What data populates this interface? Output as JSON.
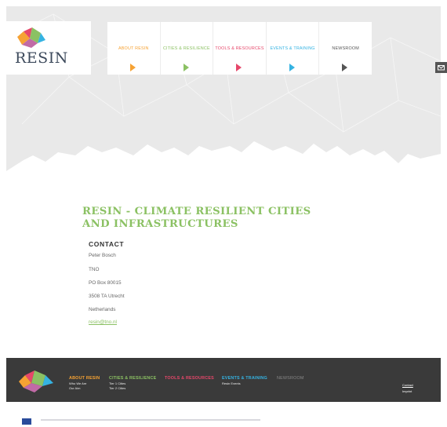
{
  "brand": {
    "name": "RESIN"
  },
  "nav": [
    {
      "label": "ABOUT RESIN",
      "color": "#f6a233"
    },
    {
      "label": "CITIES & RESILIENCE",
      "color": "#8bc163"
    },
    {
      "label": "TOOLS & RESOURCES",
      "color": "#e6476a"
    },
    {
      "label": "EVENTS & TRAINING",
      "color": "#35b3e2"
    },
    {
      "label": "NEWSROOM",
      "color": "#555555"
    }
  ],
  "content": {
    "title": "RESIN - CLIMATE RESILIENT CITIES AND INFRASTRUCTURES",
    "contact_heading": "CONTACT",
    "contact_lines": [
      "Peter Bosch",
      "TNO",
      "PO Box 80015",
      "3508 TA Utrecht",
      "Netherlands"
    ],
    "contact_email": "resin@tno.nl"
  },
  "footer": {
    "columns": [
      {
        "title": "ABOUT RESIN",
        "color": "#f6a233",
        "items": [
          "Who We Are",
          "Our Aim"
        ]
      },
      {
        "title": "CITIES & RESILIENCE",
        "color": "#8bc163",
        "items": [
          "Tier 1 Cities",
          "Tier 2 Cities"
        ]
      },
      {
        "title": "TOOLS & RESOURCES",
        "color": "#e6476a",
        "items": []
      },
      {
        "title": "EVENTS & TRAINING",
        "color": "#35b3e2",
        "items": [
          "Resin Events"
        ]
      },
      {
        "title": "NEWSROOM",
        "color": "#888888",
        "items": []
      }
    ],
    "links": [
      "Contact",
      "Imprint"
    ]
  }
}
